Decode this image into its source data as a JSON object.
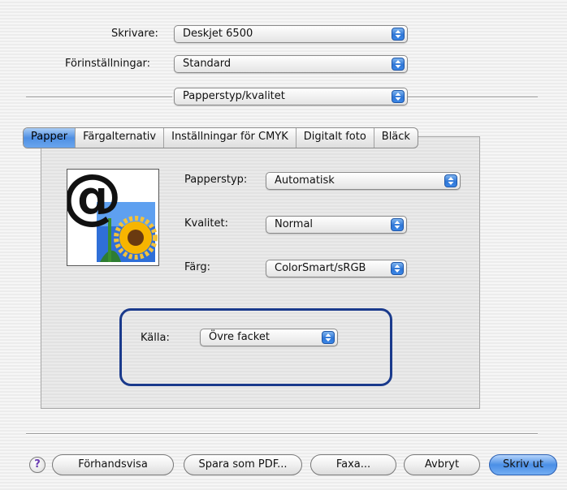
{
  "printer": {
    "label": "Skrivare:",
    "value": "Deskjet 6500"
  },
  "presets": {
    "label": "Förinställningar:",
    "value": "Standard"
  },
  "section": {
    "value": "Papperstyp/kvalitet"
  },
  "tabs": [
    "Papper",
    "Färgalternativ",
    "Inställningar för CMYK",
    "Digitalt foto",
    "Bläck"
  ],
  "paper": {
    "type": {
      "label": "Papperstyp:",
      "value": "Automatisk"
    },
    "quality": {
      "label": "Kvalitet:",
      "value": "Normal"
    },
    "color": {
      "label": "Färg:",
      "value": "ColorSmart/sRGB"
    },
    "source": {
      "label": "Källa:",
      "value": "Övre facket"
    }
  },
  "buttons": {
    "help": "?",
    "preview": "Förhandsvisa",
    "save_pdf": "Spara som PDF...",
    "fax": "Faxa...",
    "cancel": "Avbryt",
    "print": "Skriv ut"
  },
  "colors": {
    "accent": "#3a86e6",
    "highlight_border": "#1a3a8c"
  }
}
